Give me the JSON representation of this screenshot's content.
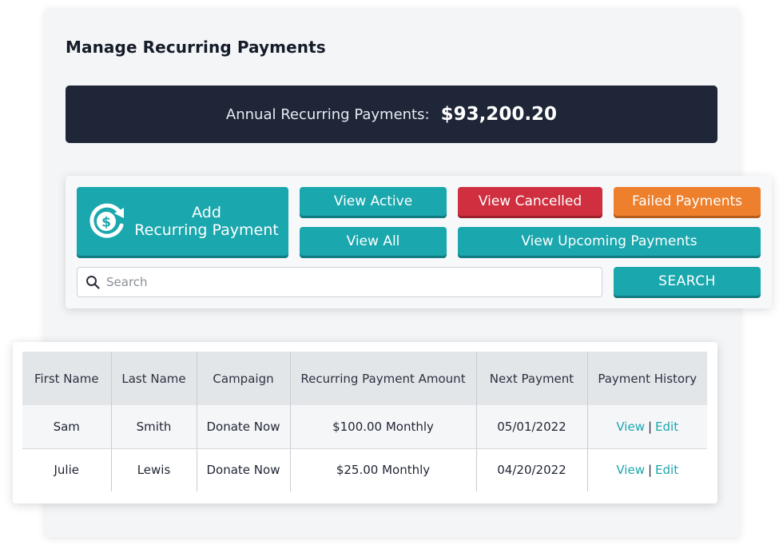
{
  "page": {
    "title": "Manage Recurring Payments",
    "banner_label": "Annual Recurring Payments:",
    "banner_value": "$93,200.20"
  },
  "toolbar": {
    "add_button": {
      "line1": "Add",
      "line2": "Recurring Payment",
      "icon": "dollar-refresh-icon"
    },
    "view_active": "View Active",
    "view_all": "View All",
    "view_cancelled": "View Cancelled",
    "failed_payments": "Failed Payments",
    "view_upcoming": "View Upcoming Payments",
    "search_placeholder": "Search",
    "search_button": "SEARCH"
  },
  "table": {
    "headers": [
      "First Name",
      "Last Name",
      "Campaign",
      "Recurring Payment Amount",
      "Next Payment",
      "Payment History"
    ],
    "rows": [
      {
        "first": "Sam",
        "last": "Smith",
        "campaign": "Donate Now",
        "amount": "$100.00 Monthly",
        "next": "05/01/2022",
        "view": "View",
        "sep": "|",
        "edit": "Edit"
      },
      {
        "first": "Julie",
        "last": "Lewis",
        "campaign": "Donate Now",
        "amount": "$25.00 Monthly",
        "next": "04/20/2022",
        "view": "View",
        "sep": "|",
        "edit": "Edit"
      }
    ]
  },
  "colors": {
    "teal": "#1aa7ad",
    "red": "#cf2f3f",
    "orange": "#ee7f2d",
    "banner": "#1e2637"
  }
}
